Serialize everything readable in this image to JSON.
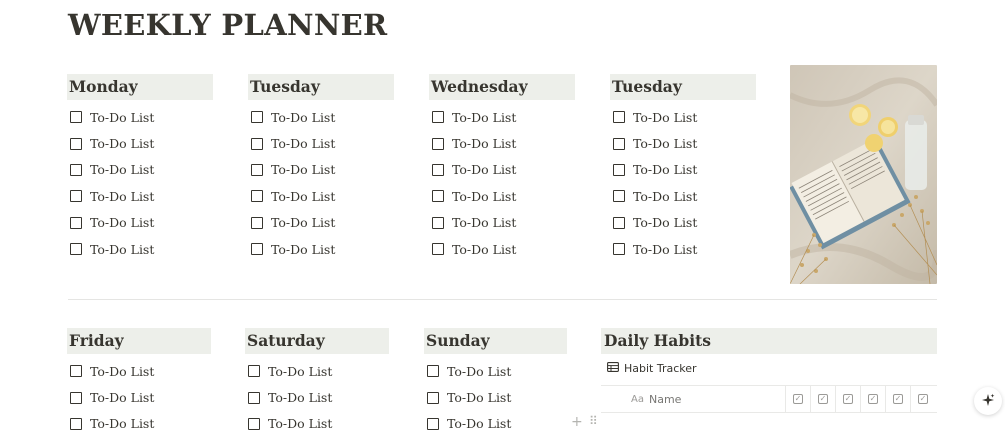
{
  "page": {
    "title": "WEEKLY PLANNER"
  },
  "week_top": [
    {
      "day": "Monday",
      "items": [
        "To-Do List",
        "To-Do List",
        "To-Do List",
        "To-Do List",
        "To-Do List",
        "To-Do List"
      ]
    },
    {
      "day": "Tuesday",
      "items": [
        "To-Do List",
        "To-Do List",
        "To-Do List",
        "To-Do List",
        "To-Do List",
        "To-Do List"
      ]
    },
    {
      "day": "Wednesday",
      "items": [
        "To-Do List",
        "To-Do List",
        "To-Do List",
        "To-Do List",
        "To-Do List",
        "To-Do List"
      ]
    },
    {
      "day": "Tuesday",
      "items": [
        "To-Do List",
        "To-Do List",
        "To-Do List",
        "To-Do List",
        "To-Do List",
        "To-Do List"
      ]
    }
  ],
  "week_bottom": [
    {
      "day": "Friday",
      "items": [
        "To-Do List",
        "To-Do List",
        "To-Do List"
      ]
    },
    {
      "day": "Saturday",
      "items": [
        "To-Do List",
        "To-Do List",
        "To-Do List"
      ]
    },
    {
      "day": "Sunday",
      "items": [
        "To-Do List",
        "To-Do List",
        "To-Do List"
      ]
    }
  ],
  "habits": {
    "title": "Daily Habits",
    "database_name": "Habit Tracker",
    "name_column": "Name",
    "name_column_icon": "Aa",
    "checkbox_columns": 6
  },
  "icons": {
    "table": "table-icon",
    "checkbox_property": "checkbox-property-icon",
    "add": "plus-icon",
    "drag": "drag-handle-icon",
    "ai": "sparkle-icon"
  },
  "colors": {
    "header_bg": "#edefea",
    "text": "#37352f"
  }
}
